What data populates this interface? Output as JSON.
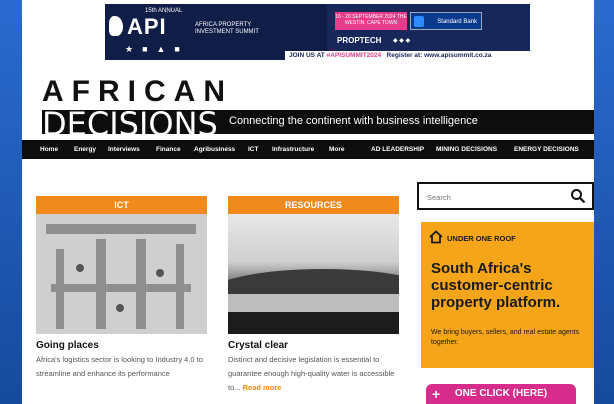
{
  "banner": {
    "edition": "15th ANNUAL",
    "brand": "API",
    "subtitle": "AFRICA PROPERTY INVESTMENT SUMMIT",
    "dates": "16 - 20 SEPTEMBER 2024 THE WESTIN, CAPE TOWN",
    "sponsor": "Standard Bank",
    "proptech": "PROPTECH",
    "join_text": "JOIN US AT",
    "hashtag": "#APISUMMIT2024",
    "register_text": "Register at: www.apisummit.co.za"
  },
  "masthead": {
    "logo_top": "AFRICAN",
    "logo_bottom": "DECISIONS",
    "tagline": "Connecting the continent with business intelligence"
  },
  "nav": {
    "items": [
      "Home",
      "Energy",
      "Interviews",
      "Finance",
      "Agribusiness",
      "ICT",
      "Infrastructure",
      "More"
    ],
    "right_items": [
      "AD LEADERSHIP",
      "MINING DECISIONS",
      "ENERGY DECISIONS"
    ]
  },
  "articles": [
    {
      "category": "ICT",
      "title": "Going places",
      "description": "Africa's logistics sector is looking to Industry 4.0 to streamline and enhance its performance"
    },
    {
      "category": "RESOURCES",
      "title": "Crystal clear",
      "description": "Distinct and decisive legislation is essential to guarantee enough high-quality water is accessible to...",
      "read_more": "Read more"
    }
  ],
  "search": {
    "placeholder": "Search"
  },
  "ad": {
    "heading": "UNDER ONE ROOF",
    "title": "South Africa's customer-centric property platform.",
    "sub": "We bring buyers, sellers, and real estate agents together."
  },
  "cta": {
    "label": "ONE CLICK (HERE)"
  },
  "colors": {
    "accent": "#f08a1c",
    "ad_bg": "#f5a519",
    "cta": "#d82c8c",
    "frame": "#1f57b0"
  }
}
